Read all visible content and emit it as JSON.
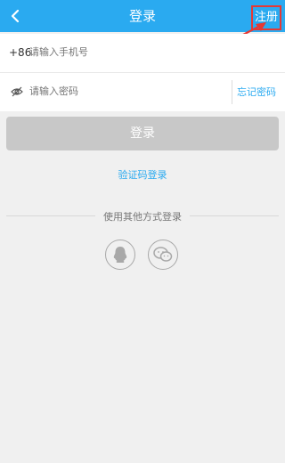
{
  "header": {
    "title": "登录",
    "register_label": "注册"
  },
  "phone": {
    "country_code": "+86",
    "placeholder": "请输入手机号"
  },
  "password": {
    "placeholder": "请输入密码",
    "forgot_label": "忘记密码"
  },
  "login_button_label": "登录",
  "sms_login_label": "验证码登录",
  "other_login": {
    "label": "使用其他方式登录",
    "options": [
      "qq-icon",
      "wechat-icon"
    ]
  },
  "colors": {
    "brand": "#2aaaf0",
    "highlight": "#e53935",
    "disabled_button": "#c8c8c8"
  }
}
